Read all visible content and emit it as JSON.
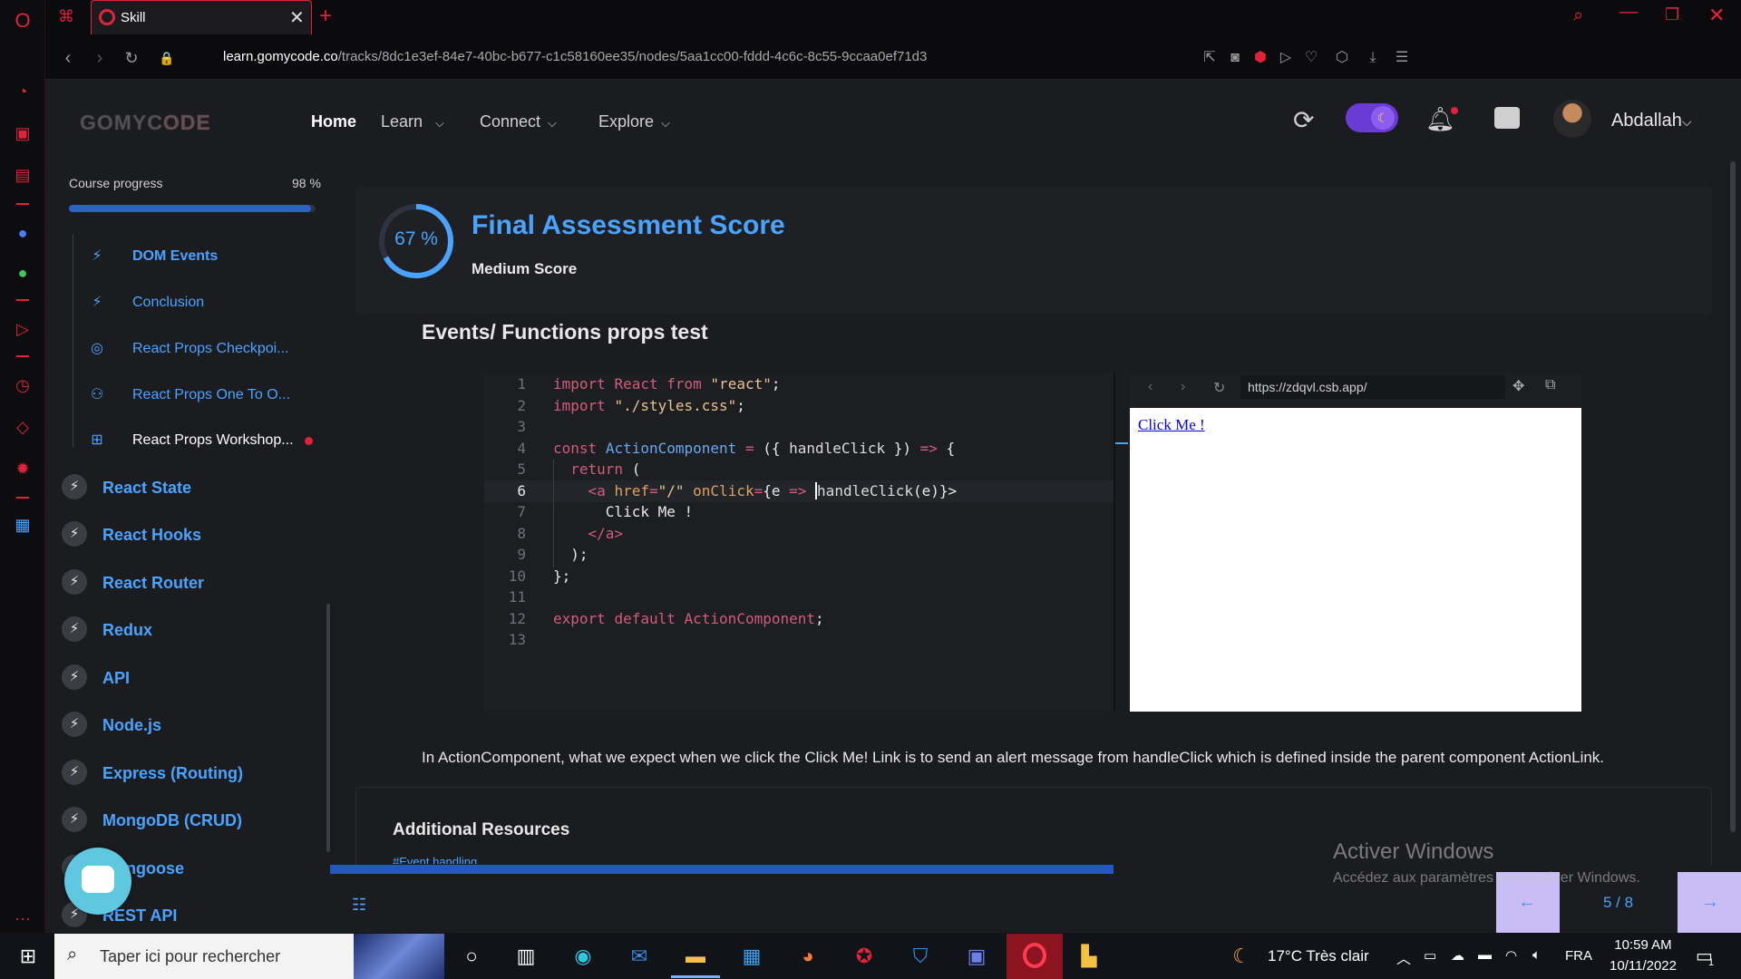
{
  "browser": {
    "tab_title": "Skill",
    "url_domain": "learn.gomycode.co",
    "url_prefix": "",
    "url_path": "/tracks/8dc1e3ef-84e7-40bc-b677-c1c58160ee35/nodes/5aa1cc00-fddd-4c6c-8c55-9ccaa0ef71d3"
  },
  "header": {
    "logo": "GOMYCODE",
    "nav": [
      "Home",
      "Learn",
      "Connect",
      "Explore"
    ],
    "user_name": "Abdallah",
    "accent": "#4aa3ff",
    "toggle_color": "#6b3bd6"
  },
  "sidebar": {
    "progress_label": "Course progress",
    "progress_value": "98 %",
    "progress_fraction": 0.98,
    "sub_items": [
      {
        "label": "DOM Events",
        "icon": "bolt-icon",
        "active": true
      },
      {
        "label": "Conclusion",
        "icon": "bolt-icon",
        "active": false
      },
      {
        "label": "React Props Checkpoi...",
        "icon": "target-icon",
        "active": false
      },
      {
        "label": "React Props One To O...",
        "icon": "people-icon",
        "active": false
      },
      {
        "label": "React Props Workshop...",
        "icon": "workshop-icon",
        "active": false,
        "current": true
      }
    ],
    "modules": [
      "React State",
      "React Hooks",
      "React Router",
      "Redux",
      "API",
      "Node.js",
      "Express (Routing)",
      "MongoDB (CRUD)",
      "Mongoose",
      "REST API"
    ]
  },
  "score": {
    "percent": "67 %",
    "percent_fraction": 0.67,
    "title": "Final Assessment Score",
    "subtitle": "Medium Score"
  },
  "question": {
    "title": "Events/ Functions props test",
    "description": "In ActionComponent, what we expect when we click the Click Me! Link is to send an alert message from handleClick which is defined inside the parent component ActionLink."
  },
  "code": {
    "line_numbers": [
      "1",
      "2",
      "3",
      "4",
      "5",
      "6",
      "7",
      "8",
      "9",
      "10",
      "11",
      "12",
      "13"
    ],
    "current_line": 6
  },
  "preview": {
    "url": "https://zdqvl.csb.app/",
    "link_text": "Click Me !"
  },
  "resources": {
    "title": "Additional Resources",
    "first_link": "#Event handling"
  },
  "pager": {
    "label": "5 / 8"
  },
  "watermark": {
    "title": "Activer Windows",
    "subtitle": "Accédez aux paramètres pour activer Windows."
  },
  "taskbar": {
    "search_placeholder": "Taper ici pour rechercher",
    "weather": "17°C  Très clair",
    "lang": "FRA",
    "time": "10:59 AM",
    "date": "10/11/2022",
    "notification_count": "1"
  }
}
